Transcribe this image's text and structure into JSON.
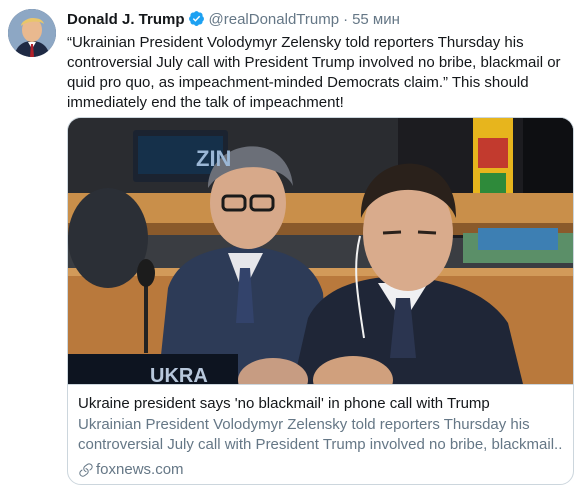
{
  "tweet": {
    "author_name": "Donald J. Trump",
    "handle": "@realDonaldTrump",
    "separator": "·",
    "time": "55 мин",
    "text": "“Ukrainian President Volodymyr Zelensky told reporters Thursday his controversial July call with President Trump involved no bribe, blackmail or quid pro quo, as impeachment-minded Democrats claim.” This should immediately end the talk of impeachment!"
  },
  "card": {
    "image_sign_left": "ZIN",
    "image_sign_bottom": "UKRA",
    "title": "Ukraine president says 'no blackmail' in phone call with Trump",
    "description_line1": "Ukrainian President Volodymyr Zelensky told reporters Thursday his",
    "description_line2": "controversial July call with President Trump involved no bribe, blackmail...",
    "domain": "foxnews.com"
  },
  "icons": {
    "verified": "verified-badge-icon",
    "link": "link-icon"
  },
  "colors": {
    "text_primary": "#14171a",
    "text_secondary": "#657786",
    "border": "#ccd6dd",
    "verified_blue": "#1da1f2"
  }
}
